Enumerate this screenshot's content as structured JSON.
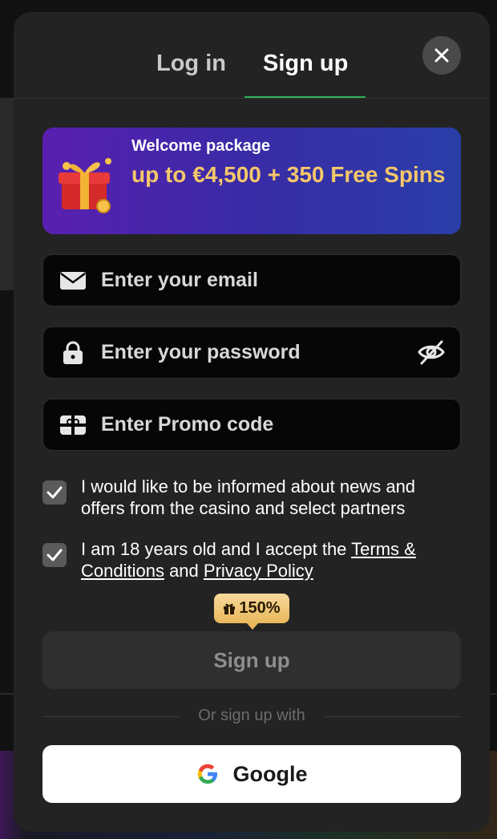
{
  "tabs": {
    "login": "Log in",
    "signup": "Sign up",
    "active": "signup"
  },
  "banner": {
    "title": "Welcome package",
    "offer": "up to €4,500 + 350 Free Spins"
  },
  "fields": {
    "email_placeholder": "Enter your email",
    "password_placeholder": "Enter your password",
    "promo_placeholder": "Enter Promo code"
  },
  "consent": {
    "news_text": "I would like to be informed about news and offers from the casino and select partners",
    "news_checked": true,
    "age_prefix": "I am 18 years old and I accept the ",
    "terms_link": "Terms & Conditions",
    "and": " and ",
    "privacy_link": "Privacy Policy",
    "age_checked": true
  },
  "bonus_badge": "150%",
  "signup_button": "Sign up",
  "divider": "Or sign up with",
  "google_button": "Google",
  "icons": [
    "close-icon",
    "gift-icon",
    "mail-icon",
    "lock-icon",
    "eye-off-icon",
    "promo-ticket-icon",
    "check-icon",
    "google-icon"
  ],
  "colors": {
    "accent_green": "#2fb35a",
    "gold": "#f4c76a",
    "modal_bg": "#232323"
  }
}
